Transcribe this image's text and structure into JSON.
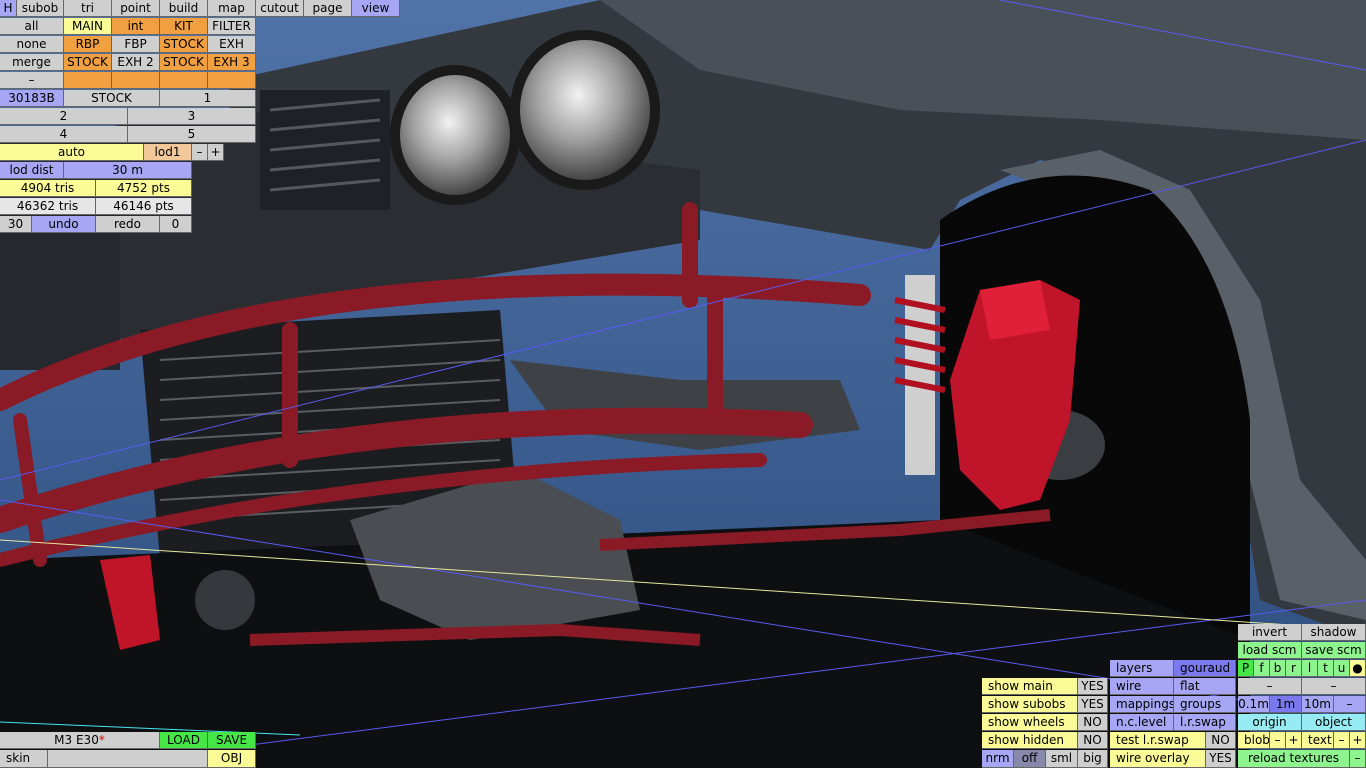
{
  "menu": {
    "h": "H",
    "items": [
      "subob",
      "tri",
      "point",
      "build",
      "map",
      "cutout",
      "page",
      "view"
    ]
  },
  "selection": {
    "row1": [
      "all",
      "MAIN",
      "int",
      "KIT",
      "FILTER"
    ],
    "row2": [
      "none",
      "RBP",
      "FBP",
      "STOCK",
      "EXH"
    ],
    "row3": [
      "merge",
      "STOCK",
      "EXH 2",
      "STOCK",
      "EXH 3"
    ],
    "row4": [
      "–",
      "",
      "",
      "",
      ""
    ]
  },
  "part": {
    "code": "30183B",
    "variant": "STOCK",
    "index": "1"
  },
  "pages": [
    "2",
    "3",
    "4",
    "5"
  ],
  "lod": {
    "mode": "auto",
    "level": "lod1",
    "minus": "–",
    "plus": "+",
    "dist_label": "lod dist",
    "dist_value": "30 m"
  },
  "stats": {
    "tris_sel": "4904 tris",
    "pts_sel": "4752 pts",
    "tris_total": "46362 tris",
    "pts_total": "46146 pts"
  },
  "history": {
    "count": "30",
    "undo": "undo",
    "redo": "redo",
    "redo_count": "0"
  },
  "file": {
    "name": "M3 E30",
    "modified_mark": "*",
    "load": "LOAD",
    "save": "SAVE",
    "skin": "skin",
    "obj": "OBJ"
  },
  "display": {
    "show_main": "show main",
    "show_main_val": "YES",
    "show_subobs": "show subobs",
    "show_subobs_val": "YES",
    "show_wheels": "show wheels",
    "show_wheels_val": "NO",
    "show_hidden": "show hidden",
    "show_hidden_val": "NO",
    "nrm": "nrm",
    "off": "off",
    "sml": "sml",
    "big": "big"
  },
  "render": {
    "layers": "layers",
    "gouraud": "gouraud",
    "wire": "wire",
    "flat": "flat",
    "mappings": "mappings",
    "groups": "groups",
    "nc_level": "n.c.level",
    "lr_swap": "l.r.swap",
    "test_lr_swap": "test l.r.swap",
    "test_lr_swap_val": "NO",
    "wire_overlay": "wire overlay",
    "wire_overlay_val": "YES"
  },
  "scene_ctrl": {
    "invert": "invert",
    "shadow": "shadow",
    "load_scm": "load scm",
    "save_scm": "save scm",
    "flags": [
      "P",
      "f",
      "b",
      "r",
      "l",
      "t",
      "u",
      "●"
    ],
    "minus1": "–",
    "minus2": "–",
    "grid": [
      "0.1m",
      "1m",
      "10m",
      "–"
    ],
    "origin": "origin",
    "object": "object",
    "blob": "blob",
    "blob_minus": "–",
    "blob_plus": "+",
    "text": "text",
    "text_minus": "–",
    "text_plus": "+",
    "reload": "reload textures",
    "reload_minus": "–"
  }
}
